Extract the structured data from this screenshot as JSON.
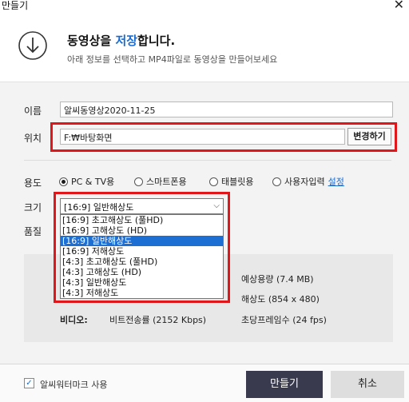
{
  "window": {
    "title": "만들기",
    "close_glyph": "✕"
  },
  "header": {
    "title_prefix": "동영상을 ",
    "title_accent": "저장",
    "title_suffix": "합니다.",
    "subtitle": "아래 정보를 선택하고 MP4파일로 동영상을 만들어보세요",
    "icon": "download-arrow-circle-icon"
  },
  "form": {
    "name_label": "이름",
    "name_value": "알씨동영상2020-11-25",
    "location_label": "위치",
    "location_value": "F:₩바탕화면",
    "change_button": "변경하기",
    "usage_label": "용도",
    "usage_options": [
      "PC & TV용",
      "스마트폰용",
      "태블릿용",
      "사용자입력"
    ],
    "usage_selected": "PC & TV용",
    "settings_link": "설정",
    "size_label": "크기",
    "size_selected": "[16:9] 일반해상도",
    "size_options": [
      "[16:9] 초고해상도 (풀HD)",
      "[16:9] 고해상도 (HD)",
      "[16:9] 일반해상도",
      "[16:9] 저해상도",
      "[4:3] 초고해상도 (풀HD)",
      "[4:3] 고해상도 (HD)",
      "[4:3] 일반해상도",
      "[4:3] 저해상도"
    ],
    "quality_label": "품질"
  },
  "info": {
    "expected_size": "예상용량 (7.4 MB)",
    "resolution": "해상도 (854 x 480)",
    "video_label": "비디오:",
    "bitrate": "비트전송률 (2152 Kbps)",
    "fps": "초당프레임수 (24 fps)"
  },
  "footer": {
    "watermark_label": "알씨워터마크 사용",
    "watermark_checked": true,
    "create_button": "만들기",
    "cancel_button": "취소"
  },
  "colors": {
    "accent": "#1a6bd1",
    "highlight_box": "#e0161a",
    "primary_button": "#3a3a4e"
  }
}
